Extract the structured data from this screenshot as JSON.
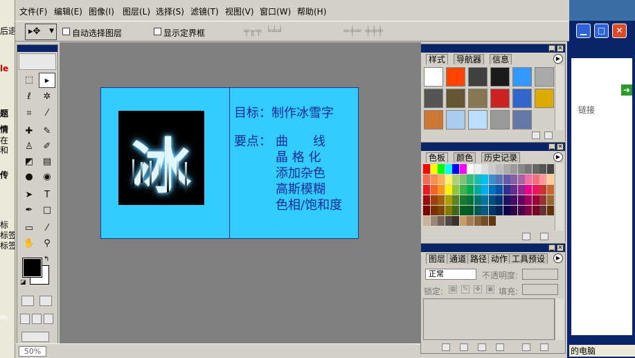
{
  "left_strip": {
    "fragments": [
      "后退",
      "le",
      "题",
      "情",
      "在",
      "和",
      "传",
      "标",
      "标签",
      "标签",
      "Mi"
    ]
  },
  "right_window": {
    "tab_label": "链接",
    "caption": "的电脑"
  },
  "menu": [
    "文件(F)",
    "编辑(E)",
    "图像(I)",
    "图层(L)",
    "选择(S)",
    "滤镜(T)",
    "视图(V)",
    "窗口(W)",
    "帮助(H)"
  ],
  "options": {
    "auto_select_label": "自动选择图层",
    "show_bounds_label": "显示定界框"
  },
  "canvas": {
    "ice_char": "冰",
    "goal_line": "目标：制作冰雪字",
    "points_label": "要点：",
    "points": [
      "曲　　线",
      "晶 格 化",
      "添加杂色",
      "高斯模糊",
      "色相/饱和度"
    ]
  },
  "status": {
    "zoom": "50%"
  },
  "styles_palette": {
    "tabs": [
      "样式",
      "导航器",
      "信息"
    ],
    "swatch_colors": [
      "#ffffff",
      "#ff4400",
      "#404040",
      "#1a1a1a",
      "#3399ff",
      "#aaaaaa",
      "#555555",
      "#665533",
      "#887755",
      "#cc2222",
      "#3366cc",
      "#ddaa00",
      "#cc7733",
      "#aaccee",
      "#bbddff",
      "#999999",
      "#6677aa",
      ""
    ]
  },
  "swatches_palette": {
    "tabs": [
      "色板",
      "颜色",
      "历史记录"
    ]
  },
  "layers_palette": {
    "tabs": [
      "图层",
      "通道",
      "路径",
      "动作",
      "工具预设"
    ],
    "blend_mode": "正常",
    "opacity_label": "不透明度:",
    "lock_label": "锁定:",
    "fill_label": "填充:"
  },
  "colors": {
    "canvas_bg": "#33ccff",
    "canvas_text": "#1a2a99",
    "workspace": "#808080",
    "title_bar": "#0a246a"
  }
}
